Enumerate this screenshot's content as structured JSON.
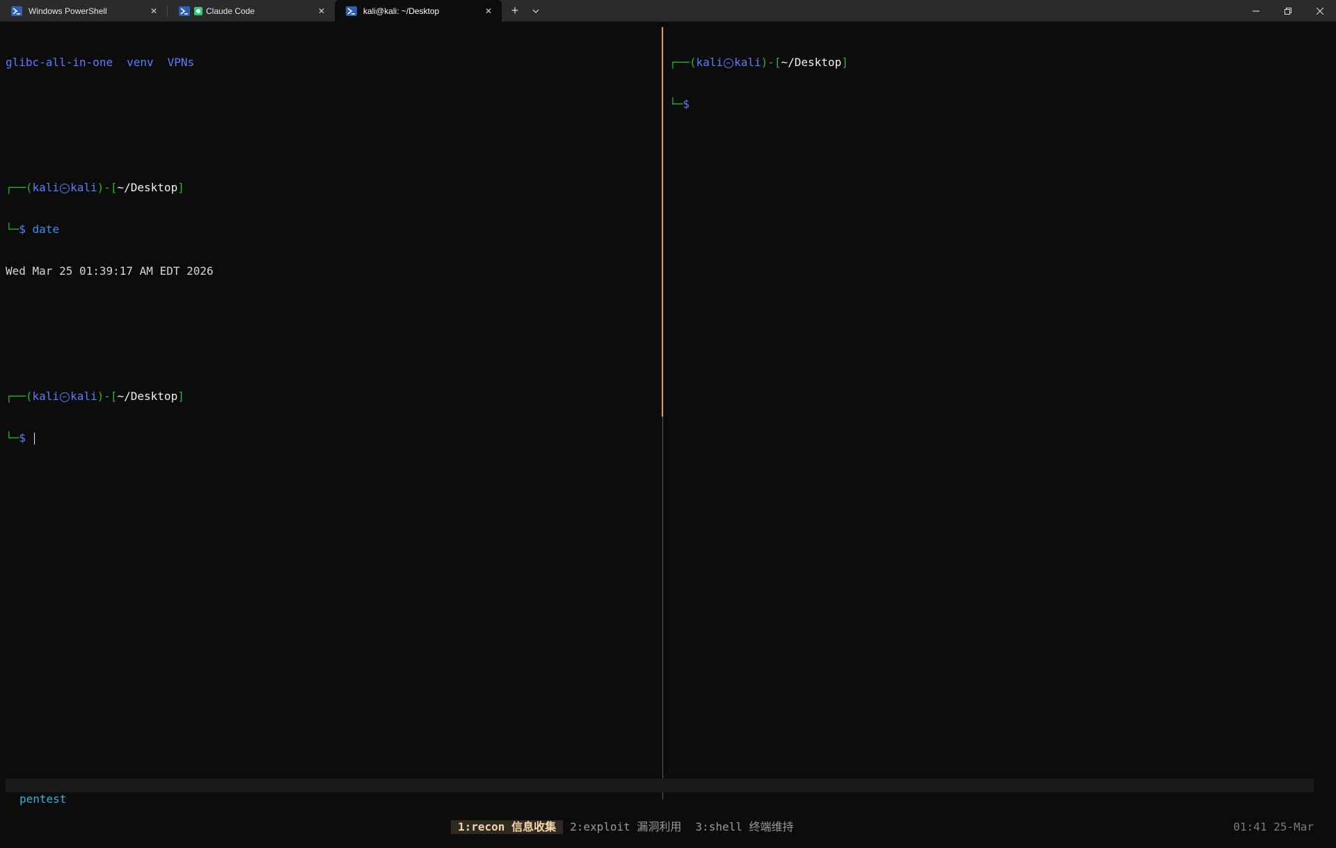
{
  "tabs": [
    {
      "label": "Windows PowerShell",
      "icon": "powershell-icon",
      "active": false
    },
    {
      "label": "Claude Code",
      "icon": "claude-icon",
      "active": false
    },
    {
      "label": "kali@kali: ~/Desktop",
      "icon": "powershell-icon",
      "active": true
    }
  ],
  "tab_actions": {
    "new_tab": "+",
    "dropdown": "⌄"
  },
  "window_controls": {
    "minimize": "—",
    "restore": "❐",
    "close": "✕"
  },
  "left_pane": {
    "ls_items": [
      "glibc-all-in-one",
      "venv",
      "VPNs"
    ],
    "prompt_user": "kali",
    "prompt_host": "kali",
    "prompt_path": "~/Desktop",
    "prompt_dollar": "$",
    "command": "date",
    "output": "Wed Mar 25 01:39:17 AM EDT 2026"
  },
  "right_pane": {
    "prompt_user": "kali",
    "prompt_host": "kali",
    "prompt_path": "~/Desktop",
    "prompt_dollar": "$"
  },
  "status_bar": {
    "session": "pentest",
    "windows": [
      {
        "label": "1:recon 信息收集",
        "current": true
      },
      {
        "label": "2:exploit 漏洞利用",
        "current": false
      },
      {
        "label": "3:shell 终端维持",
        "current": false
      }
    ],
    "clock": "01:41 25-Mar"
  },
  "colors": {
    "background": "#0c0c0c",
    "prompt_green": "#26b82f",
    "prompt_blue": "#5b7dff",
    "active_pane_border": "#f29d3a"
  }
}
